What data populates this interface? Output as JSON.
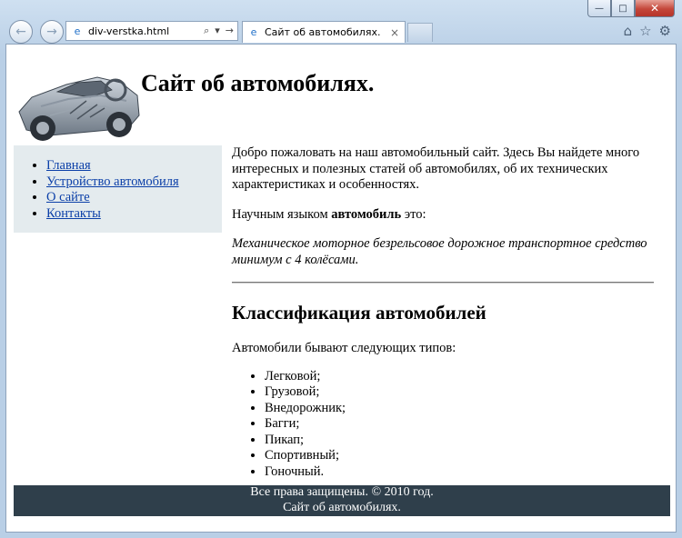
{
  "browser": {
    "address": "div-verstka.html",
    "tab_title": "Сайт об автомобилях.",
    "tab_close": "×",
    "win_min": "—",
    "win_max": "□",
    "win_close": "✕",
    "back_glyph": "←",
    "forward_glyph": "→",
    "addr_search_glyph": "⌕",
    "addr_dropdown_glyph": "▾",
    "addr_go_glyph": "→",
    "home_glyph": "⌂",
    "favorites_glyph": "☆",
    "tools_glyph": "⚙",
    "page_icon_glyph": "e"
  },
  "site": {
    "title": "Сайт об автомобилях.",
    "nav": [
      "Главная",
      "Устройство автомобиля",
      "О сайте",
      "Контакты"
    ],
    "intro": "Добро пожаловать на наш автомобильный сайт. Здесь Вы найдете много интересных и полезных статей об автомобилях, об их технических характеристиках и особенностях.",
    "definition_prefix": "Научным языком ",
    "definition_bold": "автомобиль",
    "definition_suffix": " это:",
    "definition_quote": "Механическое моторное безрельсовое дорожное транспортное средство минимум с 4 колёсами.",
    "classification_heading": "Классификация автомобилей",
    "types_intro": "Автомобили бывают следующих типов:",
    "types": [
      "Легковой;",
      "Грузовой;",
      "Внедорожник;",
      "Багги;",
      "Пикап;",
      "Спортивный;",
      "Гоночный."
    ],
    "footer_line1": "Все права защищены. © 2010 год.",
    "footer_line2": "Сайт об автомобилях."
  },
  "colors": {
    "sidebar_bg": "#e4ebee",
    "footer_bg": "#2f3f4b",
    "link": "#0b3fa8"
  }
}
